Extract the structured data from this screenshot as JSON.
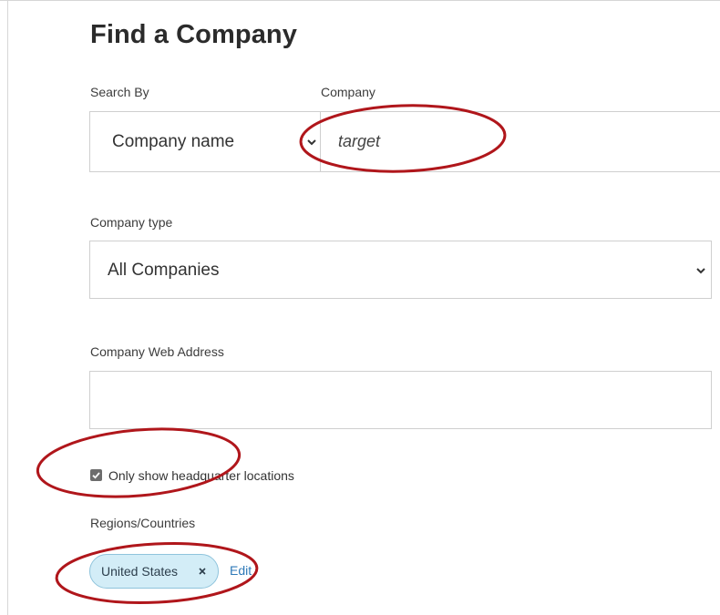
{
  "page": {
    "title": "Find a Company"
  },
  "search_by": {
    "label": "Search By",
    "selected": "Company name"
  },
  "company": {
    "label": "Company",
    "value": "target"
  },
  "company_type": {
    "label": "Company type",
    "selected": "All Companies"
  },
  "web_address": {
    "label": "Company Web Address",
    "value": ""
  },
  "headquarters": {
    "label": "Only show headquarter locations",
    "checked": true
  },
  "regions": {
    "label": "Regions/Countries",
    "chips": [
      {
        "label": "United States",
        "remove_icon": "close-icon"
      }
    ],
    "edit_label": "Edit"
  },
  "icons": {
    "dropdown": "chevron-down-icon",
    "checkbox": "checkmark-icon"
  },
  "colors": {
    "annotation_ring": "#b0161b",
    "chip_background": "#d3edf7",
    "chip_border": "#8fc4dc",
    "link": "#2f7ab8",
    "checkbox_fill": "#6d6d6d"
  }
}
